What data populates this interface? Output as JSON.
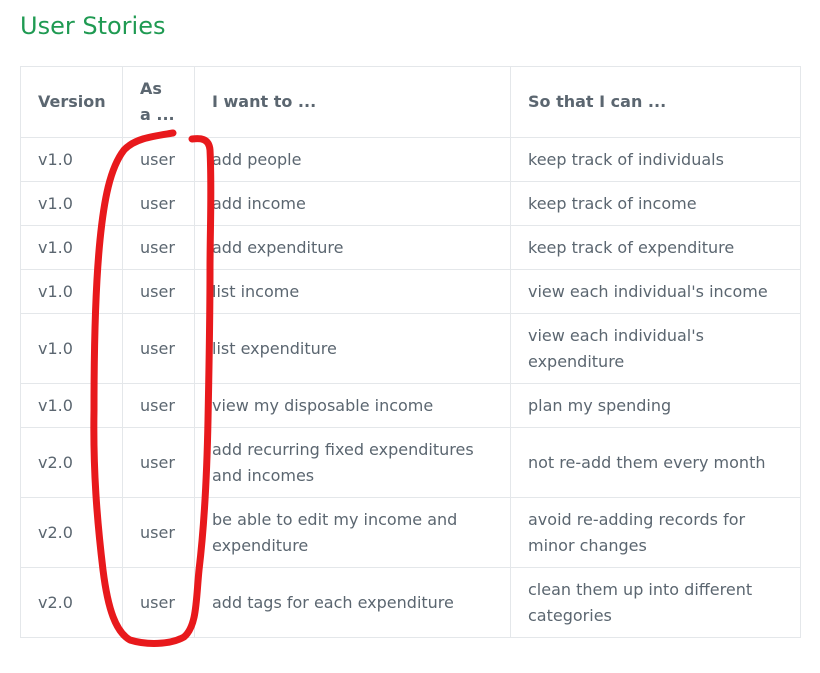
{
  "title": "User Stories",
  "table": {
    "headers": [
      "Version",
      "As a ...",
      "I want to ...",
      "So that I can ..."
    ],
    "rows": [
      {
        "version": "v1.0",
        "role": "user",
        "want": "add people",
        "benefit": "keep track of individuals"
      },
      {
        "version": "v1.0",
        "role": "user",
        "want": "add income",
        "benefit": "keep track of income"
      },
      {
        "version": "v1.0",
        "role": "user",
        "want": "add expenditure",
        "benefit": "keep track of expenditure"
      },
      {
        "version": "v1.0",
        "role": "user",
        "want": "list income",
        "benefit": "view each individual's income"
      },
      {
        "version": "v1.0",
        "role": "user",
        "want": "list expenditure",
        "benefit": "view each individual's expenditure"
      },
      {
        "version": "v1.0",
        "role": "user",
        "want": "view my disposable income",
        "benefit": "plan my spending"
      },
      {
        "version": "v2.0",
        "role": "user",
        "want": "add recurring fixed expenditures and incomes",
        "benefit": "not re-add them every month"
      },
      {
        "version": "v2.0",
        "role": "user",
        "want": "be able to edit my income and expenditure",
        "benefit": "avoid re-adding records for minor changes"
      },
      {
        "version": "v2.0",
        "role": "user",
        "want": "add tags for each expenditure",
        "benefit": "clean them up into different categories"
      }
    ]
  },
  "colors": {
    "title": "#1f9a52",
    "text": "#5b6670",
    "border": "#e4e7ea",
    "annotation": "#e8191c"
  }
}
